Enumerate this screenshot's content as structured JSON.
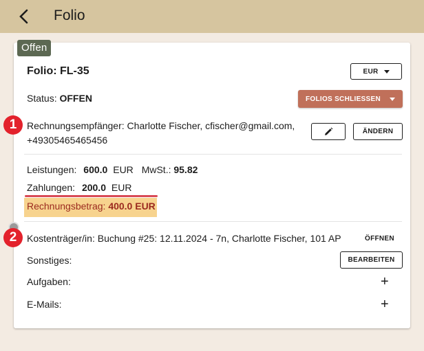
{
  "topbar": {
    "title": "Folio"
  },
  "status_chip": "Offen",
  "folio": {
    "title": "Folio: FL-35",
    "currency": "EUR",
    "status_label": "Status:",
    "status_value": "OFFEN",
    "close_button": "FOLIOS SCHLIESSEN"
  },
  "recipient": {
    "label": "Rechnungsempfänger:",
    "value_line1": "Charlotte Fischer, cfischer@gmail.com,",
    "value_line2": "+49305465465456",
    "change_button": "ÄNDERN"
  },
  "totals": {
    "services_label": "Leistungen:",
    "services_value": "600.0",
    "services_currency": "EUR",
    "tax_label": "MwSt.:",
    "tax_value": "95.82",
    "payments_label": "Zahlungen:",
    "payments_value": "200.0",
    "payments_currency": "EUR",
    "invoice_label": "Rechnungsbetrag:",
    "invoice_value": "400.0 EUR"
  },
  "payer": {
    "label": "Kostenträger/in:",
    "value": "Buchung #25: 12.11.2024 - 7n, Charlotte Fischer, 101 AP",
    "open_button": "ÖFFNEN"
  },
  "misc": {
    "other_label": "Sonstiges:",
    "edit_button": "BEARBEITEN",
    "tasks_label": "Aufgaben:",
    "emails_label": "E-Mails:",
    "plus": "+"
  },
  "badges": [
    "1",
    "2"
  ],
  "colors": {
    "topbar": "#d6c59f",
    "primary": "#c0705a",
    "chip": "#5c6852",
    "badge": "#e3222c",
    "highlight": "#f7d38e",
    "invoice_text": "#9b2a1f"
  }
}
